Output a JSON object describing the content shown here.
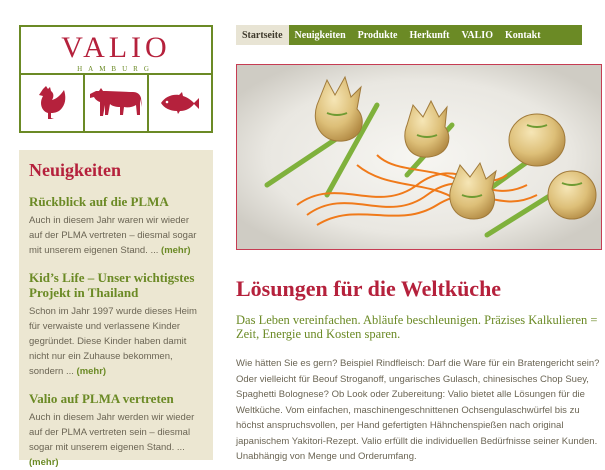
{
  "logo": {
    "title": "VALIO",
    "subtitle": "HAMBURG",
    "animals": [
      "chicken-icon",
      "cow-icon",
      "fish-icon"
    ],
    "color_brand": "#b5213c",
    "color_frame": "#6b8a25"
  },
  "nav": {
    "items": [
      "Startseite",
      "Neuigkeiten",
      "Produkte",
      "Herkunft",
      "VALIO",
      "Kontakt"
    ],
    "active": "Startseite"
  },
  "sidebar": {
    "heading": "Neuigkeiten",
    "news": [
      {
        "title": "Rückblick auf die PLMA",
        "text": "Auch in diesem Jahr waren wir wieder auf der PLMA vertreten – diesmal sogar mit unserem eigenen Stand. ...",
        "more": "(mehr)"
      },
      {
        "title": "Kid’s Life – Unser wichtigstes Projekt in Thailand",
        "text": "Schon im Jahr 1997 wurde dieses Heim für verwaiste und verlassene Kinder gegründet. Diese Kinder haben damit nicht nur ein Zuhause bekommen, sondern ...",
        "more": "(mehr)"
      },
      {
        "title": "Valio auf PLMA vertreten",
        "text": "Auch in diesem Jahr werden wir wieder auf der PLMA vertreten sein – diesmal sogar mit unserem eigenen Stand. ...",
        "more": "(mehr)"
      }
    ]
  },
  "main": {
    "title": "Lösungen für die Weltküche",
    "lead": "Das Leben vereinfachen. Abläufe beschleunigen. Präzises Kalkulieren = Zeit, Energie und Kosten sparen.",
    "body": "Wie hätten Sie es gern? Beispiel Rindfleisch: Darf die Ware für ein Bratengericht sein? Oder vielleicht für Beouf Stroganoff, ungarisches Gulasch, chinesisches Chop Suey, Spaghetti Bolognese? Ob Look oder Zubereitung: Valio bietet alle Lösungen für die Weltküche. Vom einfachen, maschinengeschnittenen Ochsengulaschwürfel bis zu höchst anspruchsvollen, per Hand gefertigten Hähnchenspießen nach original japanischem Yakitori-Rezept. Valio erfüllt die individuellen Bedürfnisse seiner Kunden. Unabhängig von Menge und Orderumfang."
  }
}
